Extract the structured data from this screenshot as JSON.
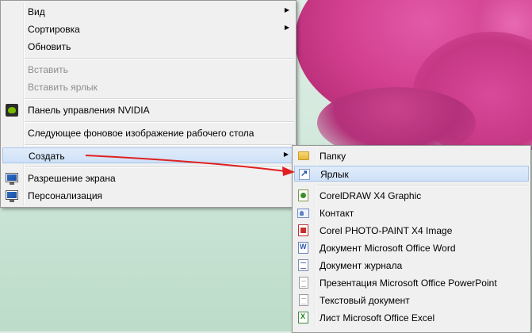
{
  "context_menu": {
    "items": [
      {
        "label": "Вид",
        "has_submenu": true,
        "enabled": true
      },
      {
        "label": "Сортировка",
        "has_submenu": true,
        "enabled": true
      },
      {
        "label": "Обновить",
        "has_submenu": false,
        "enabled": true
      },
      {
        "label": "Вставить",
        "has_submenu": false,
        "enabled": false
      },
      {
        "label": "Вставить ярлык",
        "has_submenu": false,
        "enabled": false
      },
      {
        "label": "Панель управления NVIDIA",
        "has_submenu": false,
        "enabled": true,
        "icon": "nvidia-icon"
      },
      {
        "label": "Следующее фоновое изображение рабочего стола",
        "has_submenu": false,
        "enabled": true
      },
      {
        "label": "Создать",
        "has_submenu": true,
        "enabled": true,
        "highlighted": true
      },
      {
        "label": "Разрешение экрана",
        "has_submenu": false,
        "enabled": true,
        "icon": "monitor-icon"
      },
      {
        "label": "Персонализация",
        "has_submenu": false,
        "enabled": true,
        "icon": "monitor-icon"
      }
    ],
    "submenu_arrow": "▶"
  },
  "new_submenu": {
    "items": [
      {
        "label": "Папку",
        "icon": "folder-icon"
      },
      {
        "label": "Ярлык",
        "icon": "shortcut-icon",
        "highlighted": true
      },
      {
        "label": "CorelDRAW X4 Graphic",
        "icon": "coreldraw-icon"
      },
      {
        "label": "Контакт",
        "icon": "contact-icon"
      },
      {
        "label": "Corel PHOTO-PAINT X4 Image",
        "icon": "photopaint-icon"
      },
      {
        "label": "Документ Microsoft Office Word",
        "icon": "word-icon"
      },
      {
        "label": "Документ журнала",
        "icon": "journal-icon"
      },
      {
        "label": "Презентация Microsoft Office PowerPoint",
        "icon": "document-icon"
      },
      {
        "label": "Текстовый документ",
        "icon": "text-document-icon"
      },
      {
        "label": "Лист Microsoft Office Excel",
        "icon": "excel-icon"
      }
    ]
  },
  "colors": {
    "menu_bg": "#f0f0f0",
    "highlight": "#cfe1f7",
    "annotation_arrow": "#e02020",
    "wallpaper_flower": "#d2408f"
  }
}
